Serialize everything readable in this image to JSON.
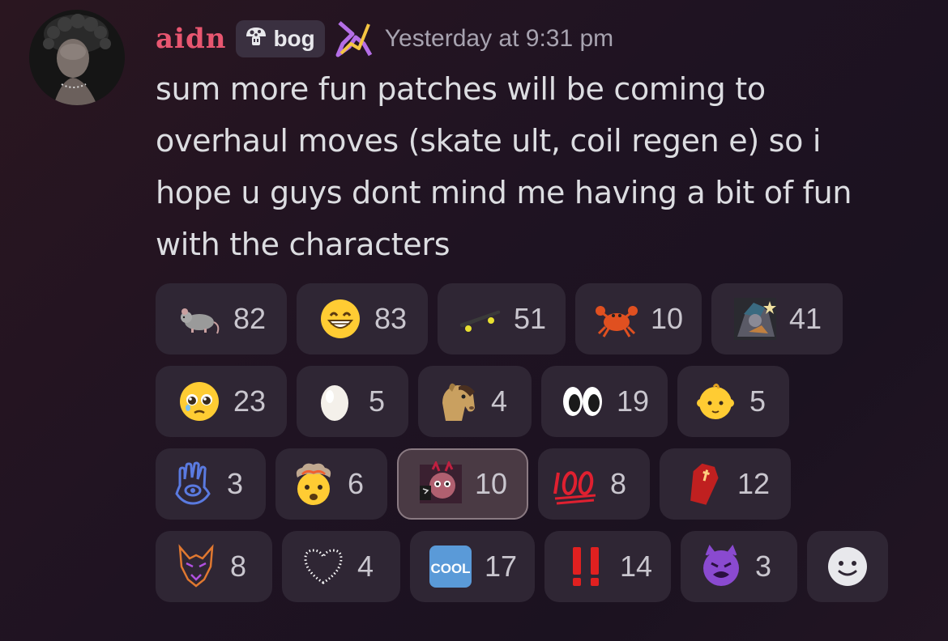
{
  "message": {
    "author": "aidn",
    "tag": "bog",
    "timestamp": "Yesterday at 9:31 pm",
    "content_lines": [
      "sum more fun patches will be coming to",
      "overhaul moves (skate ult, coil regen e) so i",
      "hope u guys dont mind me having a bit of fun",
      "with the characters"
    ]
  },
  "reactions": [
    {
      "icon": "rat-icon",
      "count": "82"
    },
    {
      "icon": "grin-icon",
      "count": "83"
    },
    {
      "icon": "skateboard-icon",
      "count": "51"
    },
    {
      "icon": "crab-icon",
      "count": "10"
    },
    {
      "icon": "custom-character-emoji",
      "count": "41"
    },
    {
      "icon": "pleading-face-icon",
      "count": "23"
    },
    {
      "icon": "egg-icon",
      "count": "5"
    },
    {
      "icon": "horse-icon",
      "count": "4"
    },
    {
      "icon": "eyes-icon",
      "count": "19"
    },
    {
      "icon": "baby-icon",
      "count": "5"
    },
    {
      "icon": "hamsa-icon",
      "count": "3"
    },
    {
      "icon": "exploding-head-icon",
      "count": "6"
    },
    {
      "icon": "custom-demon-emoji",
      "count": "10",
      "active": true
    },
    {
      "icon": "hundred-points-icon",
      "count": "8"
    },
    {
      "icon": "coffin-icon",
      "count": "12"
    },
    {
      "icon": "wolf-icon",
      "count": "8"
    },
    {
      "icon": "heart-outline-icon",
      "count": "4"
    },
    {
      "icon": "cool-button-icon",
      "count": "17"
    },
    {
      "icon": "double-exclamation-icon",
      "count": "14"
    },
    {
      "icon": "purple-demon-icon",
      "count": "3"
    }
  ],
  "add_reaction_icon": "add-reaction-smiley-icon",
  "colors": {
    "username": "#e85670",
    "reaction_bg": "#2f2634",
    "reaction_active_bg": "#4a3a44"
  }
}
